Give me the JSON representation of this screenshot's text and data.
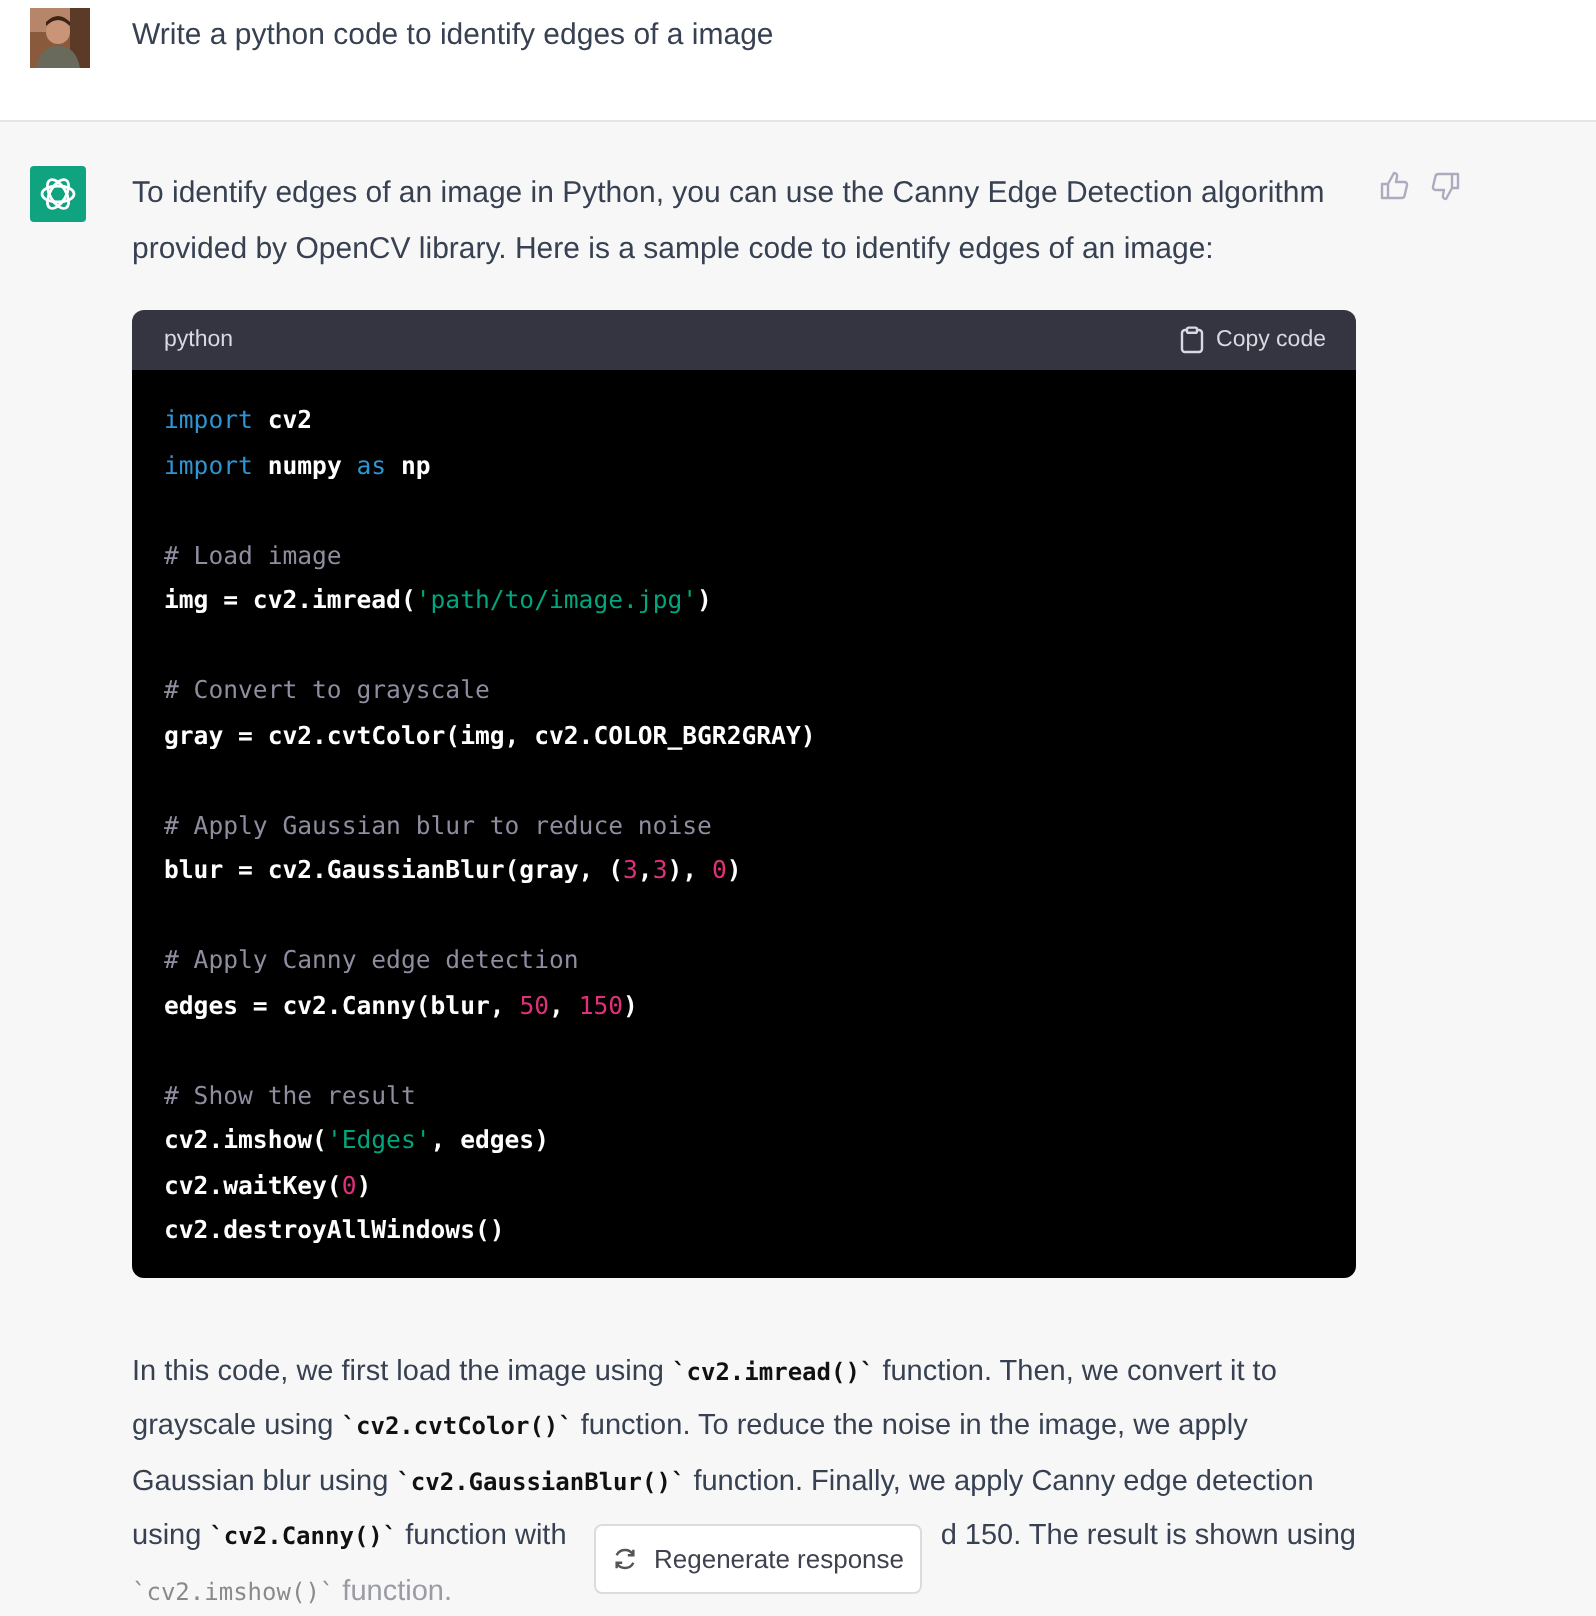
{
  "user_message": {
    "text": "Write a python code to identify edges of a image"
  },
  "assistant_message": {
    "intro": "To identify edges of an image in Python, you can use the Canny Edge Detection algorithm provided by OpenCV library. Here is a sample code to identify edges of an image:",
    "code_block": {
      "language": "python",
      "copy_label": "Copy code",
      "blocks": [
        [
          [
            {
              "kind": "keyword",
              "text": "import"
            },
            {
              "kind": "plain",
              "text": " cv2"
            }
          ],
          [
            {
              "kind": "keyword",
              "text": "import"
            },
            {
              "kind": "plain",
              "text": " numpy "
            },
            {
              "kind": "keyword",
              "text": "as"
            },
            {
              "kind": "plain",
              "text": " np"
            }
          ]
        ],
        [
          [
            {
              "kind": "comment",
              "text": "# Load image"
            }
          ],
          [
            {
              "kind": "plain",
              "text": "img = cv2.imread("
            },
            {
              "kind": "string",
              "text": "'path/to/image.jpg'"
            },
            {
              "kind": "plain",
              "text": ")"
            }
          ]
        ],
        [
          [
            {
              "kind": "comment",
              "text": "# Convert to grayscale"
            }
          ],
          [
            {
              "kind": "plain",
              "text": "gray = cv2.cvtColor(img, cv2.COLOR_BGR2GRAY)"
            }
          ]
        ],
        [
          [
            {
              "kind": "comment",
              "text": "# Apply Gaussian blur to reduce noise"
            }
          ],
          [
            {
              "kind": "plain",
              "text": "blur = cv2.GaussianBlur(gray, ("
            },
            {
              "kind": "number",
              "text": "3"
            },
            {
              "kind": "plain",
              "text": ","
            },
            {
              "kind": "number",
              "text": "3"
            },
            {
              "kind": "plain",
              "text": "), "
            },
            {
              "kind": "number",
              "text": "0"
            },
            {
              "kind": "plain",
              "text": ")"
            }
          ]
        ],
        [
          [
            {
              "kind": "comment",
              "text": "# Apply Canny edge detection"
            }
          ],
          [
            {
              "kind": "plain",
              "text": "edges = cv2.Canny(blur, "
            },
            {
              "kind": "number",
              "text": "50"
            },
            {
              "kind": "plain",
              "text": ", "
            },
            {
              "kind": "number",
              "text": "150"
            },
            {
              "kind": "plain",
              "text": ")"
            }
          ]
        ],
        [
          [
            {
              "kind": "comment",
              "text": "# Show the result"
            }
          ],
          [
            {
              "kind": "plain",
              "text": "cv2.imshow("
            },
            {
              "kind": "string",
              "text": "'Edges'"
            },
            {
              "kind": "plain",
              "text": ", edges)"
            }
          ],
          [
            {
              "kind": "plain",
              "text": "cv2.waitKey("
            },
            {
              "kind": "number",
              "text": "0"
            },
            {
              "kind": "plain",
              "text": ")"
            }
          ],
          [
            {
              "kind": "plain",
              "text": "cv2.destroyAllWindows()"
            }
          ]
        ]
      ]
    },
    "explanation_lines": [
      {
        "faded": false,
        "segments": [
          {
            "kind": "text",
            "text": "In this code, we first load the image using "
          },
          {
            "kind": "code",
            "text": "`cv2.imread()`"
          },
          {
            "kind": "text",
            "text": " function. Then, we convert it to"
          }
        ]
      },
      {
        "faded": false,
        "segments": [
          {
            "kind": "text",
            "text": "grayscale using "
          },
          {
            "kind": "code",
            "text": "`cv2.cvtColor()`"
          },
          {
            "kind": "text",
            "text": " function. To reduce the noise in the image, we apply"
          }
        ]
      },
      {
        "faded": false,
        "segments": [
          {
            "kind": "text",
            "text": "Gaussian blur using "
          },
          {
            "kind": "code",
            "text": "`cv2.GaussianBlur()`"
          },
          {
            "kind": "text",
            "text": " function. Finally, we apply Canny edge detection"
          }
        ]
      },
      {
        "faded": false,
        "segments": [
          {
            "kind": "text",
            "text": "using "
          },
          {
            "kind": "code",
            "text": "`cv2.Canny()`"
          },
          {
            "kind": "text",
            "text": " function with"
          }
        ],
        "after_cover": "d 150. The result is shown using"
      },
      {
        "faded": true,
        "segments": [
          {
            "kind": "code",
            "text": "`cv2.imshow()`"
          },
          {
            "kind": "text",
            "text": " function."
          }
        ]
      }
    ]
  },
  "regenerate_button": {
    "label": "Regenerate response"
  }
}
